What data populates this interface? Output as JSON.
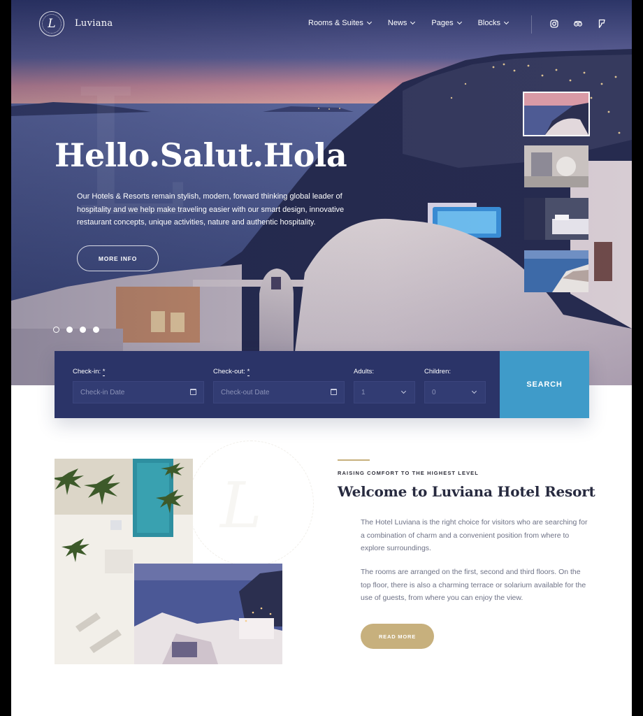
{
  "brand": {
    "name": "Luviana",
    "logo_letter": "L"
  },
  "nav": {
    "items": [
      {
        "label": "Rooms & Suites"
      },
      {
        "label": "News"
      },
      {
        "label": "Pages"
      },
      {
        "label": "Blocks"
      }
    ],
    "social_icons": [
      "instagram-icon",
      "tripadvisor-icon",
      "foursquare-icon"
    ]
  },
  "hero": {
    "headline": "Hello.Salut.Hola",
    "intro": "Our Hotels & Resorts remain stylish, modern, forward thinking global leader of hospitality and we help make traveling easier with our smart design, innovative restaurant concepts, unique activities, nature and authentic hospitality.",
    "cta": "MORE INFO",
    "slides": 4,
    "active_slide": 1,
    "thumbnails": 4,
    "active_thumbnail": 1
  },
  "booking": {
    "checkin": {
      "label": "Check-in:",
      "required": "*",
      "placeholder": "Check-in Date"
    },
    "checkout": {
      "label": "Check-out:",
      "required": "*",
      "placeholder": "Check-out Date"
    },
    "adults": {
      "label": "Adults:",
      "value": "1"
    },
    "children": {
      "label": "Children:",
      "value": "0"
    },
    "search": "SEARCH"
  },
  "welcome": {
    "eyebrow": "RAISING COMFORT TO THE HIGHEST LEVEL",
    "title": "Welcome to Luviana Hotel Resort",
    "paragraph1": "The Hotel Luviana is the right choice for visitors who are searching for a combination of charm and a convenient position from where to explore surroundings.",
    "paragraph2": "The rooms are arranged on the first, second and third floors. On the top floor, there is also a charming terrace or solarium available for the use of guests, from where you can enjoy the view.",
    "cta": "READ MORE"
  },
  "colors": {
    "navy": "#2b3468",
    "search_blue": "#3f9bc9",
    "gold": "#c7b07d",
    "heading": "#272a3f",
    "body_text": "#6e7286"
  }
}
